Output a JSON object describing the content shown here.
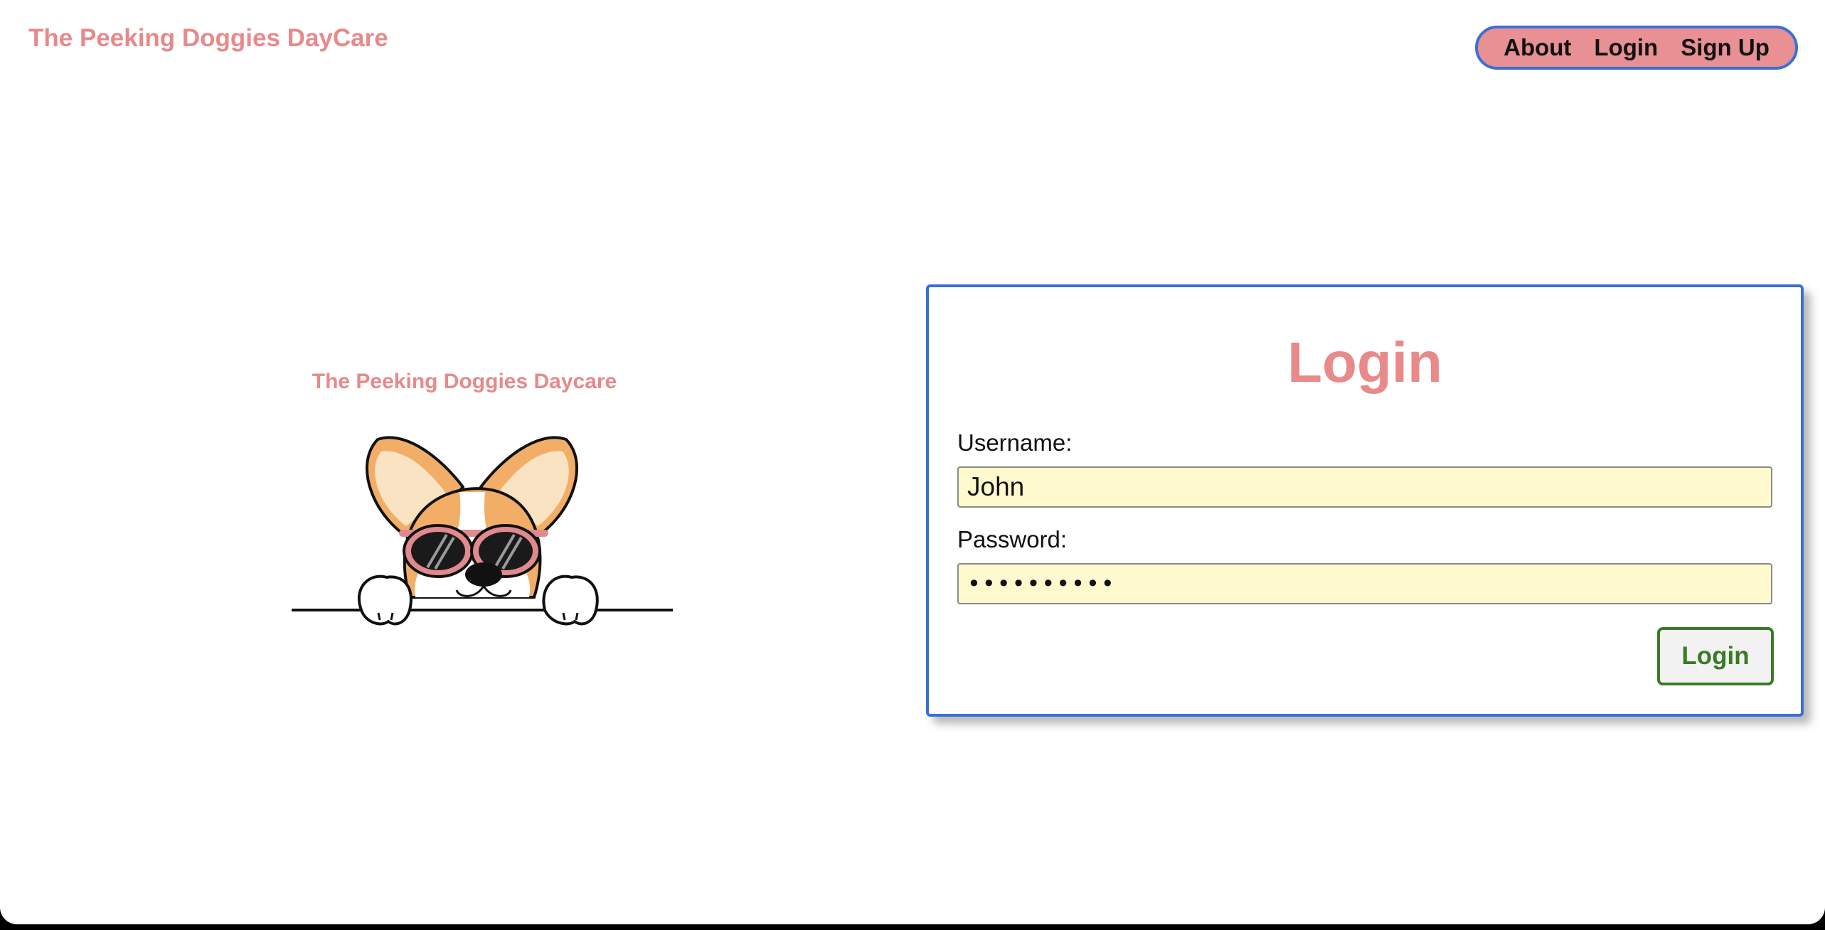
{
  "header": {
    "brand": "The Peeking Doggies DayCare",
    "nav": {
      "about": "About",
      "login": "Login",
      "signup": "Sign Up"
    }
  },
  "hero": {
    "title": "The Peeking Doggies Daycare",
    "image_icon": "corgi-with-sunglasses-icon"
  },
  "login_form": {
    "title": "Login",
    "username_label": "Username:",
    "username_value": "John",
    "password_label": "Password:",
    "password_value": "••••••••••",
    "submit_label": "Login"
  },
  "colors": {
    "brand_pink": "#e8898a",
    "nav_background": "#e89094",
    "accent_blue": "#3a6fd8",
    "input_background": "#fffacd",
    "button_green": "#3a7a26"
  }
}
